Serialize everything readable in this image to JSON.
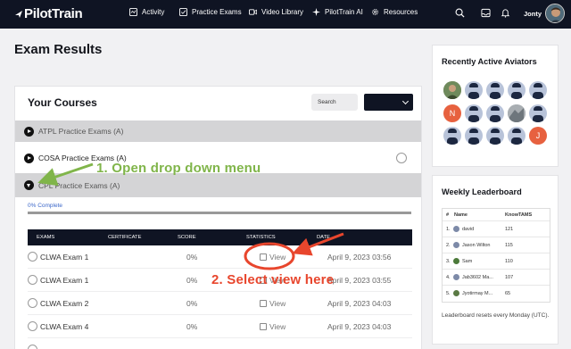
{
  "nav": {
    "logo": "PilotTrain",
    "items": [
      {
        "label": "Activity",
        "icon": "activity-icon"
      },
      {
        "label": "Practice Exams",
        "icon": "checklist-icon"
      },
      {
        "label": "Video Library",
        "icon": "video-icon"
      },
      {
        "label": "PilotTrain AI",
        "icon": "sparkle-icon"
      },
      {
        "label": "Resources",
        "icon": "gear-icon"
      }
    ],
    "username": "Jonty"
  },
  "page_title": "Exam Results",
  "courses_card": {
    "title": "Your Courses",
    "search_label": "Search",
    "courses": [
      {
        "name": "ATPL Practice Exams (A)"
      },
      {
        "name": "COSA Practice Exams (A)"
      },
      {
        "name": "CPL Practice Exams (A)"
      }
    ],
    "progress_label": "0% Complete",
    "progress": 0.0,
    "columns": [
      "EXAMS",
      "CERTIFICATE",
      "SCORE",
      "STATISTICS",
      "DATE"
    ],
    "rows": [
      {
        "exam": "CLWA Exam 1",
        "score": "0%",
        "stats": "View",
        "date": "April 9, 2023 03:56"
      },
      {
        "exam": "CLWA Exam 1",
        "score": "0%",
        "stats": "View",
        "date": "April 9, 2023 03:55"
      },
      {
        "exam": "CLWA Exam 2",
        "score": "0%",
        "stats": "View",
        "date": "April 9, 2023 04:03"
      },
      {
        "exam": "CLWA Exam 4",
        "score": "0%",
        "stats": "View",
        "date": "April 9, 2023 04:03"
      }
    ]
  },
  "aviators": {
    "title": "Recently Active Aviators",
    "letters": [
      "N",
      "J"
    ]
  },
  "leaderboard": {
    "title": "Weekly Leaderboard",
    "columns": [
      "#",
      "Name",
      "KnowTAMS"
    ],
    "rows": [
      {
        "rank": "1.",
        "name": "david",
        "score": "121"
      },
      {
        "rank": "2.",
        "name": "Jason Wilton",
        "score": "115"
      },
      {
        "rank": "3.",
        "name": "Sam",
        "score": "110"
      },
      {
        "rank": "4.",
        "name": "Jab3602 Ma...",
        "score": "107"
      },
      {
        "rank": "5.",
        "name": "Jyotirmay M...",
        "score": "65"
      }
    ],
    "note": "Leaderboard resets every Monday (UTC)."
  },
  "annotations": {
    "step1": "1. Open drop down menu",
    "step2": "2. Select view here"
  },
  "colors": {
    "nav_bg": "#0f1423",
    "accent_green": "#80b54a",
    "accent_red": "#e8462d",
    "link_blue": "#3b67c9"
  }
}
